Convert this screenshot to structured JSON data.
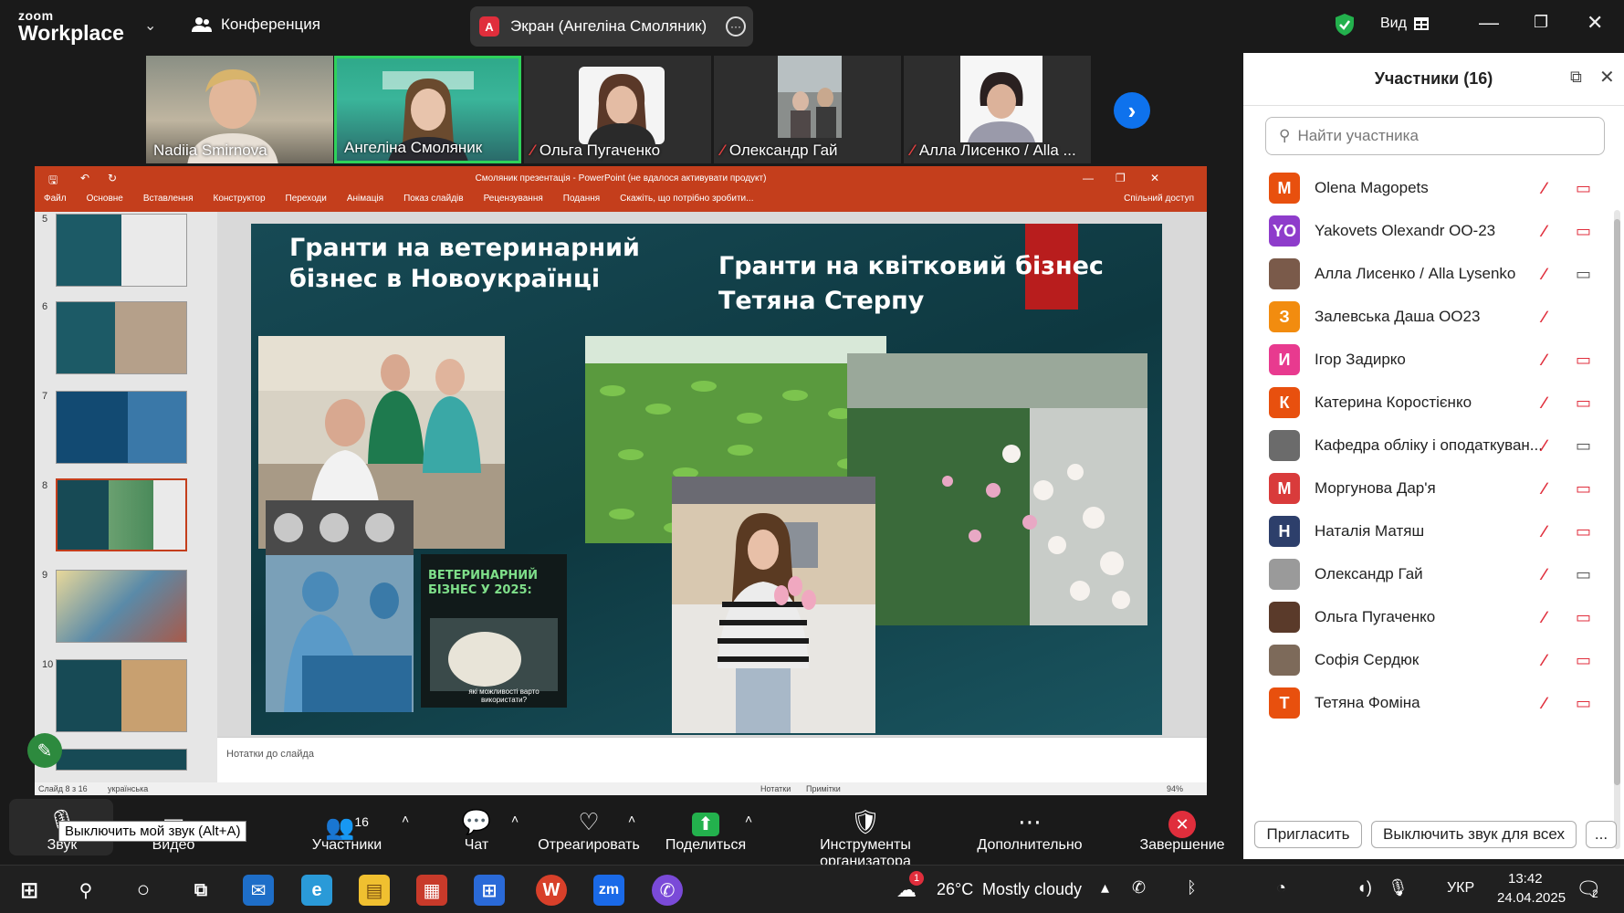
{
  "app": {
    "logo_small": "zoom",
    "logo_big": "Workplace",
    "conference_label": "Конференция",
    "screen_share_label": "Экран (Ангеліна Смоляник)",
    "screen_share_avatar": "А",
    "view_label": "Вид"
  },
  "video_strip": [
    {
      "name": "Nadiia Smirnova",
      "muted": false
    },
    {
      "name": "Ангеліна Смоляник",
      "muted": false,
      "active": true
    },
    {
      "name": "Ольга Пугаченко",
      "muted": true
    },
    {
      "name": "Олександр Гай",
      "muted": true
    },
    {
      "name": "Алла Лисенко / Alla ...",
      "muted": true
    }
  ],
  "ppt": {
    "window_title": "Смоляник презентація - PowerPoint (не вдалося активувати продукт)",
    "tabs": [
      "Файл",
      "Основне",
      "Вставлення",
      "Конструктор",
      "Переходи",
      "Анімація",
      "Показ слайдів",
      "Рецензування",
      "Подання",
      "Скажіть, що потрібно зробити..."
    ],
    "share": "Спільний доступ",
    "slide_numbers": [
      "5",
      "6",
      "7",
      "8",
      "9",
      "10"
    ],
    "slide_left_title": "Гранти на ветеринарний бізнес в Новоукраїнці",
    "slide_right_title_1": "Гранти на квітковий бізнес",
    "slide_right_title_2": "Тетяна Стерпу",
    "poster_text_1": "ВЕТЕРИНАРНИЙ",
    "poster_text_2": "БІЗНЕС У 2025:",
    "poster_text_3": "які можливості варто використати?",
    "notes_placeholder": "Нотатки до слайда",
    "status_left": "Слайд 8 з 16",
    "status_lang": "українська",
    "status_notes": "Нотатки",
    "status_comments": "Примітки",
    "zoom_level": "94%"
  },
  "participants": {
    "title": "Участники (16)",
    "search_placeholder": "Найти участника",
    "list": [
      {
        "initials": "M",
        "name": "Olena Magopets",
        "color": "#e8500e",
        "cam_on": false
      },
      {
        "initials": "YO",
        "name": "Yakovets Olexandr OO-23",
        "color": "#8e3ccb",
        "cam_on": false
      },
      {
        "initials": "",
        "name": "Алла Лисенко / Alla Lysenko",
        "color": "#7a5a4a",
        "cam_on": true
      },
      {
        "initials": "З",
        "name": "Залевська Даша ОО23",
        "color": "#f28c0f",
        "cam_on": null
      },
      {
        "initials": "И",
        "name": "Ігор Задирко",
        "color": "#e83a8f",
        "cam_on": false
      },
      {
        "initials": "К",
        "name": "Катерина Коростієнко",
        "color": "#e8500e",
        "cam_on": false
      },
      {
        "initials": "",
        "name": "Кафедра обліку і оподаткуван...",
        "color": "#6b6b6b",
        "cam_on": true
      },
      {
        "initials": "М",
        "name": "Моргунова Дар'я",
        "color": "#d93b3b",
        "cam_on": false
      },
      {
        "initials": "Н",
        "name": "Наталія Матяш",
        "color": "#2d3f6b",
        "cam_on": false
      },
      {
        "initials": "",
        "name": "Олександр Гай",
        "color": "#9a9a9a",
        "cam_on": true
      },
      {
        "initials": "",
        "name": "Ольга Пугаченко",
        "color": "#5a3a2a",
        "cam_on": false
      },
      {
        "initials": "",
        "name": "Софія Сердюк",
        "color": "#7d6a5a",
        "cam_on": false
      },
      {
        "initials": "Т",
        "name": "Тетяна Фоміна",
        "color": "#e8500e",
        "cam_on": false
      }
    ],
    "invite_label": "Пригласить",
    "mute_all_label": "Выключить звук для всех",
    "more_label": "..."
  },
  "toolbar": {
    "audio_label": "Звук",
    "video_label": "Видео",
    "participants_label": "Участники",
    "participants_count": "16",
    "chat_label": "Чат",
    "react_label": "Отреагировать",
    "share_label": "Поделиться",
    "host_tools_label": "Инструменты организатора",
    "more_label": "Дополнительно",
    "end_label": "Завершение",
    "tooltip": "Выключить мой звук (Alt+A)"
  },
  "taskbar": {
    "weather_temp": "26°C",
    "weather_desc": "Mostly cloudy",
    "weather_badge": "1",
    "lang": "УКР",
    "time": "13:42",
    "date": "24.04.2025",
    "notif_count": "2"
  },
  "colors": {
    "zoom_blue": "#0e72ed",
    "ppt_red": "#c43e1c",
    "mute_red": "#e02e3c"
  }
}
